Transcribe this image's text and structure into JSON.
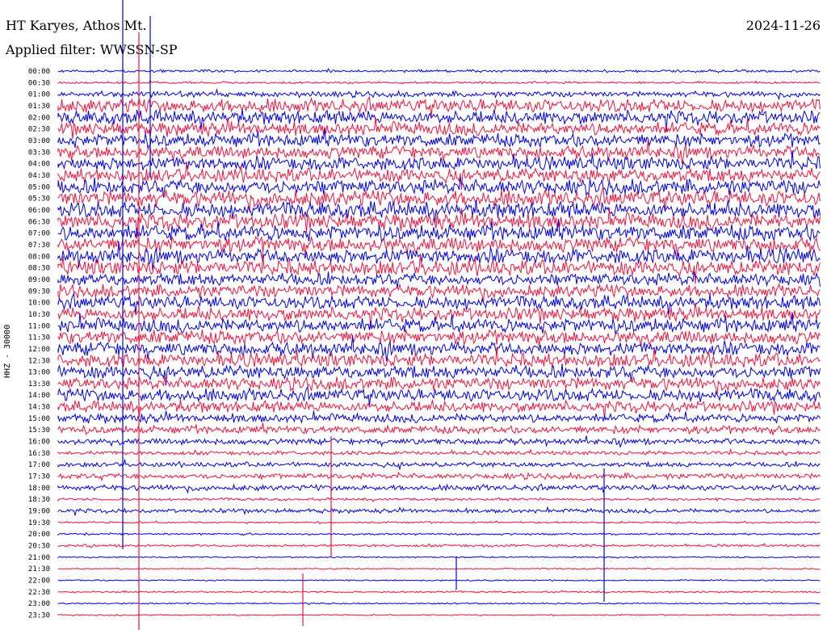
{
  "header": {
    "station": "HT Karyes, Athos Mt.",
    "filter": "Applied filter: WWSSN-SP",
    "date": "2024-11-26"
  },
  "chart_data": {
    "type": "line",
    "title": "HT Karyes, Athos Mt.",
    "subtitle": "Applied filter: WWSSN-SP",
    "date": "2024-11-26",
    "ylabel": "HHZ - 30000",
    "colors": {
      "even": "#0000e6",
      "odd": "#f0143c"
    },
    "rows": [
      {
        "t": "00:00",
        "amp": 0.15
      },
      {
        "t": "00:30",
        "amp": 0.12
      },
      {
        "t": "01:00",
        "amp": 0.35
      },
      {
        "t": "01:30",
        "amp": 0.85
      },
      {
        "t": "02:00",
        "amp": 0.85
      },
      {
        "t": "02:30",
        "amp": 0.85
      },
      {
        "t": "03:00",
        "amp": 0.85
      },
      {
        "t": "03:30",
        "amp": 0.85
      },
      {
        "t": "04:00",
        "amp": 0.9
      },
      {
        "t": "04:30",
        "amp": 0.9
      },
      {
        "t": "05:00",
        "amp": 0.95
      },
      {
        "t": "05:30",
        "amp": 1.0
      },
      {
        "t": "06:00",
        "amp": 1.0
      },
      {
        "t": "06:30",
        "amp": 1.0
      },
      {
        "t": "07:00",
        "amp": 1.0
      },
      {
        "t": "07:30",
        "amp": 1.0
      },
      {
        "t": "08:00",
        "amp": 1.0
      },
      {
        "t": "08:30",
        "amp": 1.0
      },
      {
        "t": "09:00",
        "amp": 0.8
      },
      {
        "t": "09:30",
        "amp": 0.8
      },
      {
        "t": "10:00",
        "amp": 0.85
      },
      {
        "t": "10:30",
        "amp": 0.85
      },
      {
        "t": "11:00",
        "amp": 0.9
      },
      {
        "t": "11:30",
        "amp": 0.9
      },
      {
        "t": "12:00",
        "amp": 0.9
      },
      {
        "t": "12:30",
        "amp": 0.9
      },
      {
        "t": "13:00",
        "amp": 0.85
      },
      {
        "t": "13:30",
        "amp": 0.8
      },
      {
        "t": "14:00",
        "amp": 0.8
      },
      {
        "t": "14:30",
        "amp": 0.7
      },
      {
        "t": "15:00",
        "amp": 0.55
      },
      {
        "t": "15:30",
        "amp": 0.5
      },
      {
        "t": "16:00",
        "amp": 0.4
      },
      {
        "t": "16:30",
        "amp": 0.25
      },
      {
        "t": "17:00",
        "amp": 0.3
      },
      {
        "t": "17:30",
        "amp": 0.35
      },
      {
        "t": "18:00",
        "amp": 0.35
      },
      {
        "t": "18:30",
        "amp": 0.15
      },
      {
        "t": "19:00",
        "amp": 0.25
      },
      {
        "t": "19:30",
        "amp": 0.1
      },
      {
        "t": "20:00",
        "amp": 0.1
      },
      {
        "t": "20:30",
        "amp": 0.15
      },
      {
        "t": "21:00",
        "amp": 0.05
      },
      {
        "t": "21:30",
        "amp": 0.05
      },
      {
        "t": "22:00",
        "amp": 0.05
      },
      {
        "t": "22:30",
        "amp": 0.08
      },
      {
        "t": "23:00",
        "amp": 0.05
      },
      {
        "t": "23:30",
        "amp": 0.05
      }
    ]
  }
}
